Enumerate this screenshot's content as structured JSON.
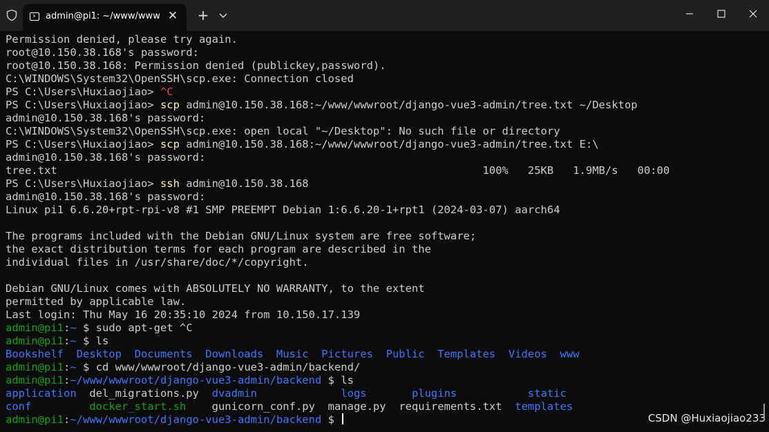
{
  "window": {
    "tab_title": "admin@pi1: ~/www/wwwroot/",
    "tab_close": "✕",
    "new_tab": "+",
    "minimize": "minimize",
    "maximize": "maximize",
    "close": "close"
  },
  "terminal": {
    "lines": [
      [
        {
          "t": "Permission denied, please try again.",
          "c": "w"
        }
      ],
      [
        {
          "t": "root@10.150.38.168's password:",
          "c": "w"
        }
      ],
      [
        {
          "t": "root@10.150.38.168: Permission denied (publickey,password).",
          "c": "w"
        }
      ],
      [
        {
          "t": "C:\\WINDOWS\\System32\\OpenSSH\\scp.exe: Connection closed",
          "c": "w"
        }
      ],
      [
        {
          "t": "PS C:\\Users\\Huxiaojiao> ",
          "c": "w"
        },
        {
          "t": "^C",
          "c": "r"
        }
      ],
      [
        {
          "t": "PS C:\\Users\\Huxiaojiao> ",
          "c": "w"
        },
        {
          "t": "scp",
          "c": "y"
        },
        {
          "t": " admin@10.150.38.168:~/www/wwwroot/django-vue3-admin/tree.txt ~/Desktop",
          "c": "w"
        }
      ],
      [
        {
          "t": "admin@10.150.38.168's password:",
          "c": "w"
        }
      ],
      [
        {
          "t": "C:\\WINDOWS\\System32\\OpenSSH\\scp.exe: open local \"~/Desktop\": No such file or directory",
          "c": "w"
        }
      ],
      [
        {
          "t": "PS C:\\Users\\Huxiaojiao> ",
          "c": "w"
        },
        {
          "t": "scp",
          "c": "y"
        },
        {
          "t": " admin@10.150.38.168:~/www/wwwroot/django-vue3-admin/tree.txt E:\\",
          "c": "w"
        }
      ],
      [
        {
          "t": "admin@10.150.38.168's password:",
          "c": "w"
        }
      ],
      [
        {
          "t": "tree.txt                                                                  100%   25KB   1.9MB/s   00:00",
          "c": "w"
        }
      ],
      [
        {
          "t": "PS C:\\Users\\Huxiaojiao> ",
          "c": "w"
        },
        {
          "t": "ssh",
          "c": "y"
        },
        {
          "t": " admin@10.150.38.168",
          "c": "w"
        }
      ],
      [
        {
          "t": "admin@10.150.38.168's password:",
          "c": "w"
        }
      ],
      [
        {
          "t": "Linux pi1 6.6.20+rpt-rpi-v8 #1 SMP PREEMPT Debian 1:6.6.20-1+rpt1 (2024-03-07) aarch64",
          "c": "w"
        }
      ],
      [
        {
          "t": "",
          "c": "w"
        }
      ],
      [
        {
          "t": "The programs included with the Debian GNU/Linux system are free software;",
          "c": "w"
        }
      ],
      [
        {
          "t": "the exact distribution terms for each program are described in the",
          "c": "w"
        }
      ],
      [
        {
          "t": "individual files in /usr/share/doc/*/copyright.",
          "c": "w"
        }
      ],
      [
        {
          "t": "",
          "c": "w"
        }
      ],
      [
        {
          "t": "Debian GNU/Linux comes with ABSOLUTELY NO WARRANTY, to the extent",
          "c": "w"
        }
      ],
      [
        {
          "t": "permitted by applicable law.",
          "c": "w"
        }
      ],
      [
        {
          "t": "Last login: Thu May 16 20:35:10 2024 from 10.150.17.139",
          "c": "w"
        }
      ],
      [
        {
          "t": "admin@pi1",
          "c": "g"
        },
        {
          "t": ":",
          "c": "w"
        },
        {
          "t": "~",
          "c": "b"
        },
        {
          "t": " $ sudo apt-get ^C",
          "c": "w"
        }
      ],
      [
        {
          "t": "admin@pi1",
          "c": "g"
        },
        {
          "t": ":",
          "c": "w"
        },
        {
          "t": "~",
          "c": "b"
        },
        {
          "t": " $ ls",
          "c": "w"
        }
      ],
      [
        {
          "t": "Bookshelf  Desktop  Documents  Downloads  Music  Pictures  Public  Templates  Videos  www",
          "c": "b"
        }
      ],
      [
        {
          "t": "admin@pi1",
          "c": "g"
        },
        {
          "t": ":",
          "c": "w"
        },
        {
          "t": "~",
          "c": "b"
        },
        {
          "t": " $ cd www/wwwroot/django-vue3-admin/backend/",
          "c": "w"
        }
      ],
      [
        {
          "t": "admin@pi1",
          "c": "g"
        },
        {
          "t": ":",
          "c": "w"
        },
        {
          "t": "~/www/wwwroot/django-vue3-admin/backend",
          "c": "b"
        },
        {
          "t": " $ ls",
          "c": "w"
        }
      ],
      [
        {
          "t": "application",
          "c": "b"
        },
        {
          "t": "  del_migrations.py  ",
          "c": "w"
        },
        {
          "t": "dvadmin",
          "c": "b"
        },
        {
          "t": "             ",
          "c": "w"
        },
        {
          "t": "logs",
          "c": "b"
        },
        {
          "t": "       ",
          "c": "w"
        },
        {
          "t": "plugins",
          "c": "b"
        },
        {
          "t": "           ",
          "c": "w"
        },
        {
          "t": "static",
          "c": "b"
        }
      ],
      [
        {
          "t": "conf",
          "c": "b"
        },
        {
          "t": "         ",
          "c": "w"
        },
        {
          "t": "docker_start.sh",
          "c": "g"
        },
        {
          "t": "    gunicorn_conf.py  manage.py  requirements.txt  ",
          "c": "w"
        },
        {
          "t": "templates",
          "c": "b"
        }
      ],
      [
        {
          "t": "admin@pi1",
          "c": "g"
        },
        {
          "t": ":",
          "c": "w"
        },
        {
          "t": "~/www/wwwroot/django-vue3-admin/backend",
          "c": "b"
        },
        {
          "t": " $ ",
          "c": "w"
        }
      ]
    ]
  },
  "watermark": "CSDN @Huxiaojiao233"
}
